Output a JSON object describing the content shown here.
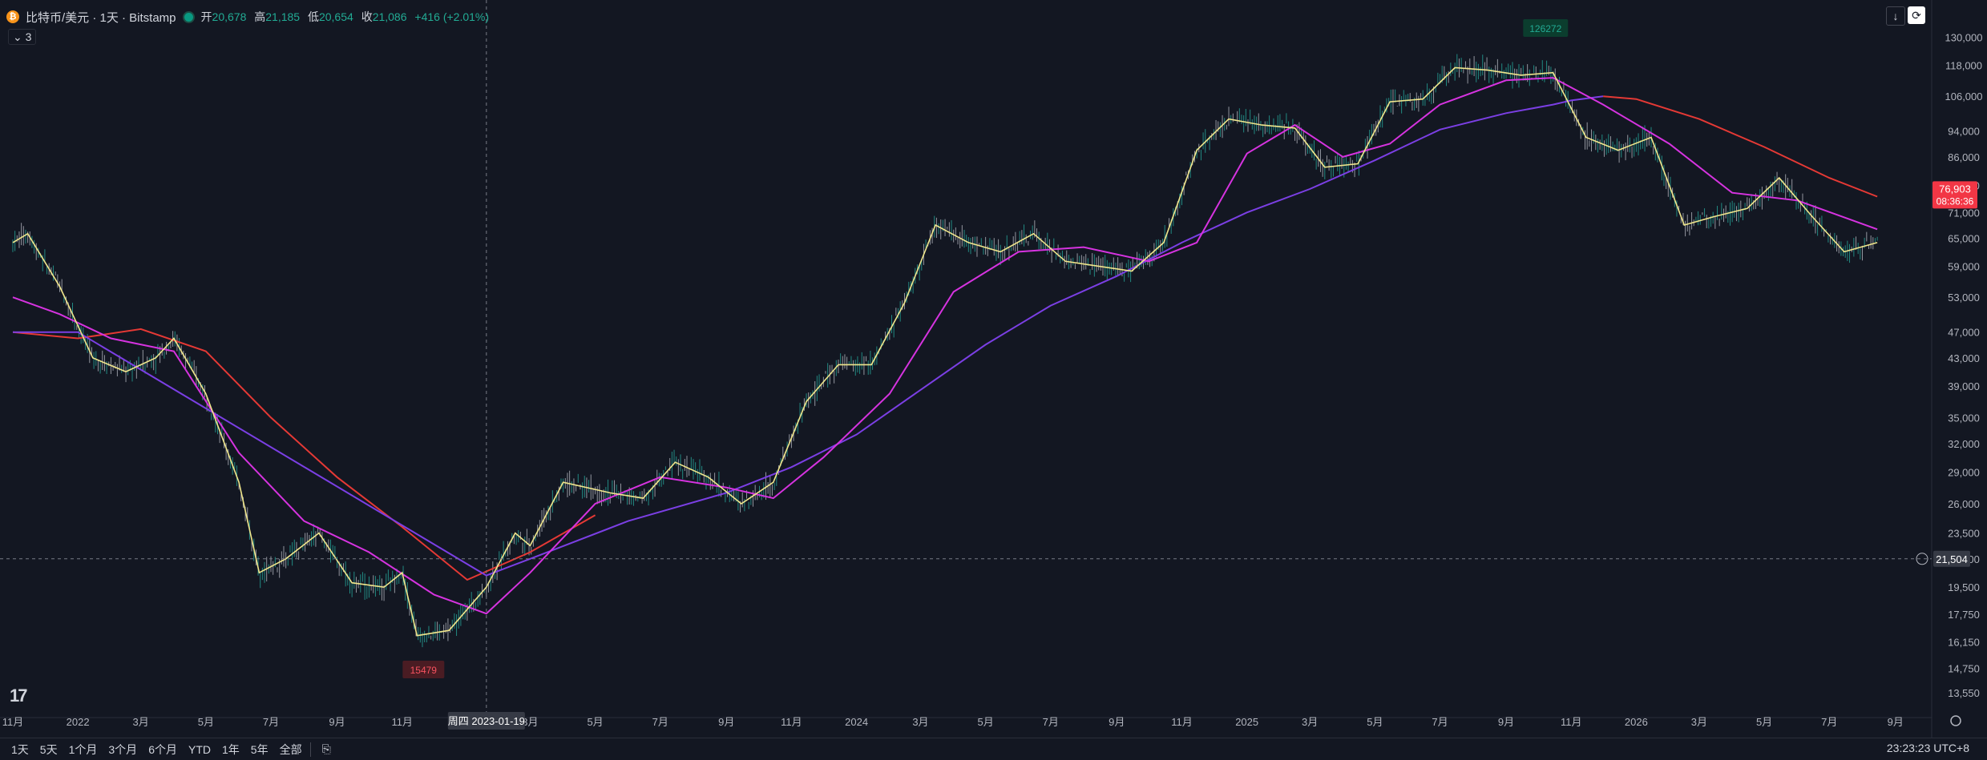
{
  "header": {
    "symbol": "比特币/美元 · 1天 · Bitstamp",
    "open_label": "开",
    "open": "20,678",
    "high_label": "高",
    "high": "21,185",
    "low_label": "低",
    "low": "20,654",
    "close_label": "收",
    "close": "21,086",
    "change": "+416 (+2.01%)",
    "indicator_count": "3"
  },
  "chart_data": {
    "type": "line",
    "scale": "log",
    "ylim": [
      13000,
      136000
    ],
    "y_ticks": [
      "130,000",
      "118,000",
      "106,000",
      "94,000",
      "86,000",
      "78,000",
      "71,000",
      "65,000",
      "59,000",
      "53,000",
      "47,000",
      "43,000",
      "39,000",
      "35,000",
      "32,000",
      "29,000",
      "26,000",
      "23,500",
      "21,500",
      "19,500",
      "17,750",
      "16,150",
      "14,750",
      "13,550"
    ],
    "x_ticks": [
      "11月",
      "2022",
      "3月",
      "5月",
      "7月",
      "9月",
      "11月",
      "1月",
      "3月",
      "5月",
      "7月",
      "9月",
      "11月",
      "2024",
      "3月",
      "5月",
      "7月",
      "9月",
      "11月",
      "2025",
      "3月",
      "5月",
      "7月",
      "9月",
      "11月",
      "2026",
      "3月",
      "5月",
      "7月",
      "9月"
    ],
    "x_axis_highlight": "周四 2023-01-19",
    "crosshair_price": "21,504",
    "last_price": "76,903",
    "countdown": "08:36:36",
    "annotations": {
      "high": "126272",
      "low": "15479"
    },
    "series": [
      {
        "color": "#e53935",
        "points": [
          [
            "2021-11-01",
            47000
          ],
          [
            "2022-01-01",
            46000
          ],
          [
            "2022-03-01",
            47500
          ],
          [
            "2022-05-01",
            44000
          ],
          [
            "2022-07-01",
            35000
          ],
          [
            "2022-09-01",
            28500
          ],
          [
            "2022-11-01",
            24000
          ],
          [
            "2023-01-01",
            20000
          ],
          [
            "2023-03-01",
            22000
          ],
          [
            "2023-05-01",
            25000
          ]
        ]
      },
      {
        "color": "#7b3fe4",
        "points": [
          [
            "2021-11-01",
            47000
          ],
          [
            "2022-01-01",
            47000
          ],
          [
            "2023-01-19",
            20300
          ],
          [
            "2023-03-01",
            21500
          ],
          [
            "2023-06-01",
            24500
          ],
          [
            "2023-09-01",
            27000
          ],
          [
            "2023-11-01",
            29500
          ],
          [
            "2024-01-01",
            33000
          ],
          [
            "2024-03-01",
            38500
          ],
          [
            "2024-05-01",
            45000
          ],
          [
            "2024-07-01",
            51500
          ],
          [
            "2024-09-01",
            57000
          ],
          [
            "2024-11-01",
            64000
          ],
          [
            "2025-01-01",
            71000
          ],
          [
            "2025-03-01",
            77000
          ],
          [
            "2025-05-01",
            85000
          ],
          [
            "2025-07-01",
            94500
          ],
          [
            "2025-09-01",
            100000
          ],
          [
            "2025-10-15",
            103000
          ],
          [
            "2025-11-01",
            104500
          ],
          [
            "2025-12-01",
            106000
          ]
        ]
      },
      {
        "color": "#e53935",
        "points": [
          [
            "2025-12-01",
            106000
          ],
          [
            "2026-01-01",
            105000
          ],
          [
            "2026-03-01",
            98000
          ],
          [
            "2026-05-01",
            89000
          ],
          [
            "2026-07-01",
            80000
          ],
          [
            "2026-08-15",
            75000
          ]
        ]
      },
      {
        "color": "#d633e0",
        "points": [
          [
            "2021-11-01",
            53000
          ],
          [
            "2021-12-15",
            50000
          ],
          [
            "2022-02-01",
            46000
          ],
          [
            "2022-04-01",
            44000
          ],
          [
            "2022-06-01",
            31000
          ],
          [
            "2022-08-01",
            24500
          ],
          [
            "2022-10-01",
            22000
          ],
          [
            "2022-12-01",
            19000
          ],
          [
            "2023-01-19",
            17800
          ],
          [
            "2023-03-01",
            20500
          ],
          [
            "2023-05-01",
            26000
          ],
          [
            "2023-07-01",
            28500
          ],
          [
            "2023-09-01",
            27500
          ],
          [
            "2023-10-15",
            26500
          ],
          [
            "2023-12-01",
            30500
          ],
          [
            "2024-02-01",
            38000
          ],
          [
            "2024-04-01",
            54000
          ],
          [
            "2024-06-01",
            62000
          ],
          [
            "2024-08-01",
            63000
          ],
          [
            "2024-10-01",
            60000
          ],
          [
            "2024-11-15",
            64000
          ],
          [
            "2025-01-01",
            87000
          ],
          [
            "2025-02-15",
            96000
          ],
          [
            "2025-04-01",
            86000
          ],
          [
            "2025-05-15",
            90000
          ],
          [
            "2025-07-01",
            103000
          ],
          [
            "2025-09-01",
            112000
          ],
          [
            "2025-10-15",
            113000
          ],
          [
            "2025-12-01",
            103000
          ],
          [
            "2026-02-01",
            90000
          ],
          [
            "2026-04-01",
            76000
          ],
          [
            "2026-06-01",
            74000
          ],
          [
            "2026-08-15",
            67000
          ]
        ]
      },
      {
        "color": "#f0e68c",
        "points": [
          [
            "2021-11-01",
            64000
          ],
          [
            "2021-11-15",
            66000
          ],
          [
            "2021-12-15",
            55000
          ],
          [
            "2022-01-15",
            43000
          ],
          [
            "2022-02-15",
            41000
          ],
          [
            "2022-03-15",
            43000
          ],
          [
            "2022-04-01",
            46000
          ],
          [
            "2022-05-01",
            38000
          ],
          [
            "2022-06-01",
            28000
          ],
          [
            "2022-06-20",
            20500
          ],
          [
            "2022-07-15",
            21500
          ],
          [
            "2022-08-15",
            23500
          ],
          [
            "2022-09-15",
            19800
          ],
          [
            "2022-10-15",
            19500
          ],
          [
            "2022-11-01",
            20500
          ],
          [
            "2022-11-15",
            16500
          ],
          [
            "2022-12-15",
            16800
          ],
          [
            "2023-01-19",
            19500
          ],
          [
            "2023-02-15",
            23500
          ],
          [
            "2023-03-01",
            22500
          ],
          [
            "2023-04-01",
            28000
          ],
          [
            "2023-05-15",
            27000
          ],
          [
            "2023-06-15",
            26500
          ],
          [
            "2023-07-15",
            30000
          ],
          [
            "2023-08-15",
            28500
          ],
          [
            "2023-09-15",
            26000
          ],
          [
            "2023-10-15",
            28000
          ],
          [
            "2023-11-15",
            37000
          ],
          [
            "2023-12-15",
            42000
          ],
          [
            "2024-01-15",
            42000
          ],
          [
            "2024-02-15",
            52000
          ],
          [
            "2024-03-15",
            68000
          ],
          [
            "2024-04-15",
            64000
          ],
          [
            "2024-05-15",
            62000
          ],
          [
            "2024-06-15",
            66000
          ],
          [
            "2024-07-15",
            60000
          ],
          [
            "2024-08-15",
            59000
          ],
          [
            "2024-09-15",
            58000
          ],
          [
            "2024-10-15",
            64000
          ],
          [
            "2024-11-15",
            88000
          ],
          [
            "2024-12-15",
            98000
          ],
          [
            "2025-01-15",
            96000
          ],
          [
            "2025-02-15",
            95000
          ],
          [
            "2025-03-15",
            83000
          ],
          [
            "2025-04-15",
            84000
          ],
          [
            "2025-05-15",
            104000
          ],
          [
            "2025-06-15",
            105000
          ],
          [
            "2025-07-15",
            117000
          ],
          [
            "2025-08-15",
            116000
          ],
          [
            "2025-09-15",
            114000
          ],
          [
            "2025-10-15",
            115000
          ],
          [
            "2025-11-15",
            92000
          ],
          [
            "2025-12-15",
            88000
          ],
          [
            "2026-01-15",
            92000
          ],
          [
            "2026-02-15",
            68000
          ],
          [
            "2026-03-15",
            70000
          ],
          [
            "2026-04-15",
            72000
          ],
          [
            "2026-05-15",
            80000
          ],
          [
            "2026-06-15",
            70000
          ],
          [
            "2026-07-15",
            62000
          ],
          [
            "2026-08-15",
            64000
          ]
        ]
      }
    ]
  },
  "bottom_bar": {
    "ranges": [
      "1天",
      "5天",
      "1个月",
      "3个月",
      "6个月",
      "YTD",
      "1年",
      "5年",
      "全部"
    ],
    "clock": "23:23:23 UTC+8"
  }
}
